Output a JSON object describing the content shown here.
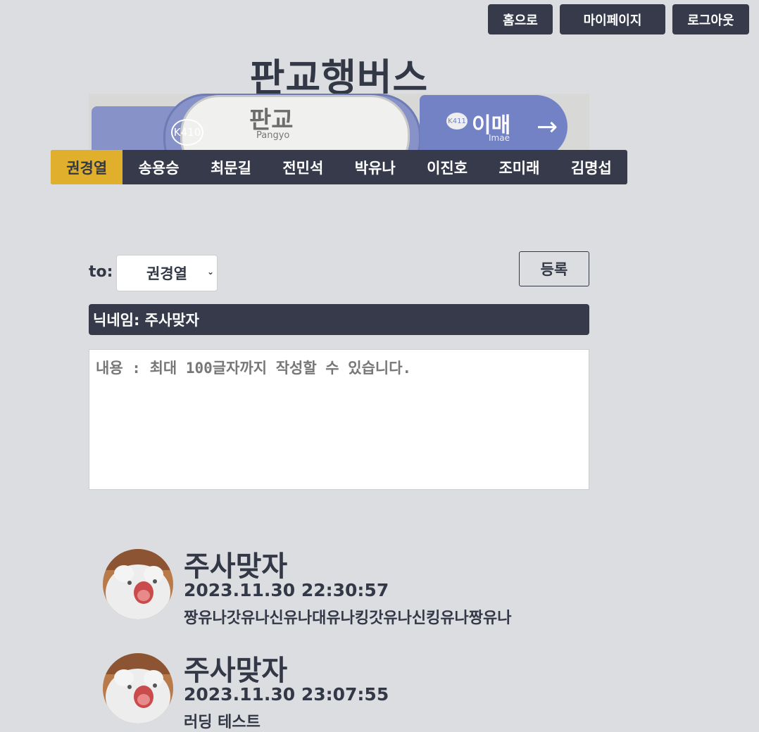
{
  "header": {
    "home_label": "홈으로",
    "mypage_label": "마이페이지",
    "logout_label": "로그아웃"
  },
  "site": {
    "title": "판교행버스"
  },
  "banner": {
    "station_code": "K410",
    "station_name": "판교",
    "station_sub": "Pangyo",
    "next_code": "K411",
    "next_name": "이매",
    "next_sub": "Imae"
  },
  "tabs": [
    {
      "label": "권경열",
      "active": true
    },
    {
      "label": "송용승",
      "active": false
    },
    {
      "label": "최문길",
      "active": false
    },
    {
      "label": "전민석",
      "active": false
    },
    {
      "label": "박유나",
      "active": false
    },
    {
      "label": "이진호",
      "active": false
    },
    {
      "label": "조미래",
      "active": false
    },
    {
      "label": "김명섭",
      "active": false
    }
  ],
  "form": {
    "to_label": "to:",
    "to_selected": "권경열",
    "register_label": "등록",
    "nickname_text": "닉네임: 주사맞자",
    "content_placeholder": "내용 : 최대 100글자까지 작성할 수 있습니다."
  },
  "comments": [
    {
      "name": "주사맞자",
      "date": "2023.11.30 22:30:57",
      "text": "짱유나갓유나신유나대유나킹갓유나신킹유나짱유나"
    },
    {
      "name": "주사맞자",
      "date": "2023.11.30 23:07:55",
      "text": "러딩 테스트"
    }
  ]
}
